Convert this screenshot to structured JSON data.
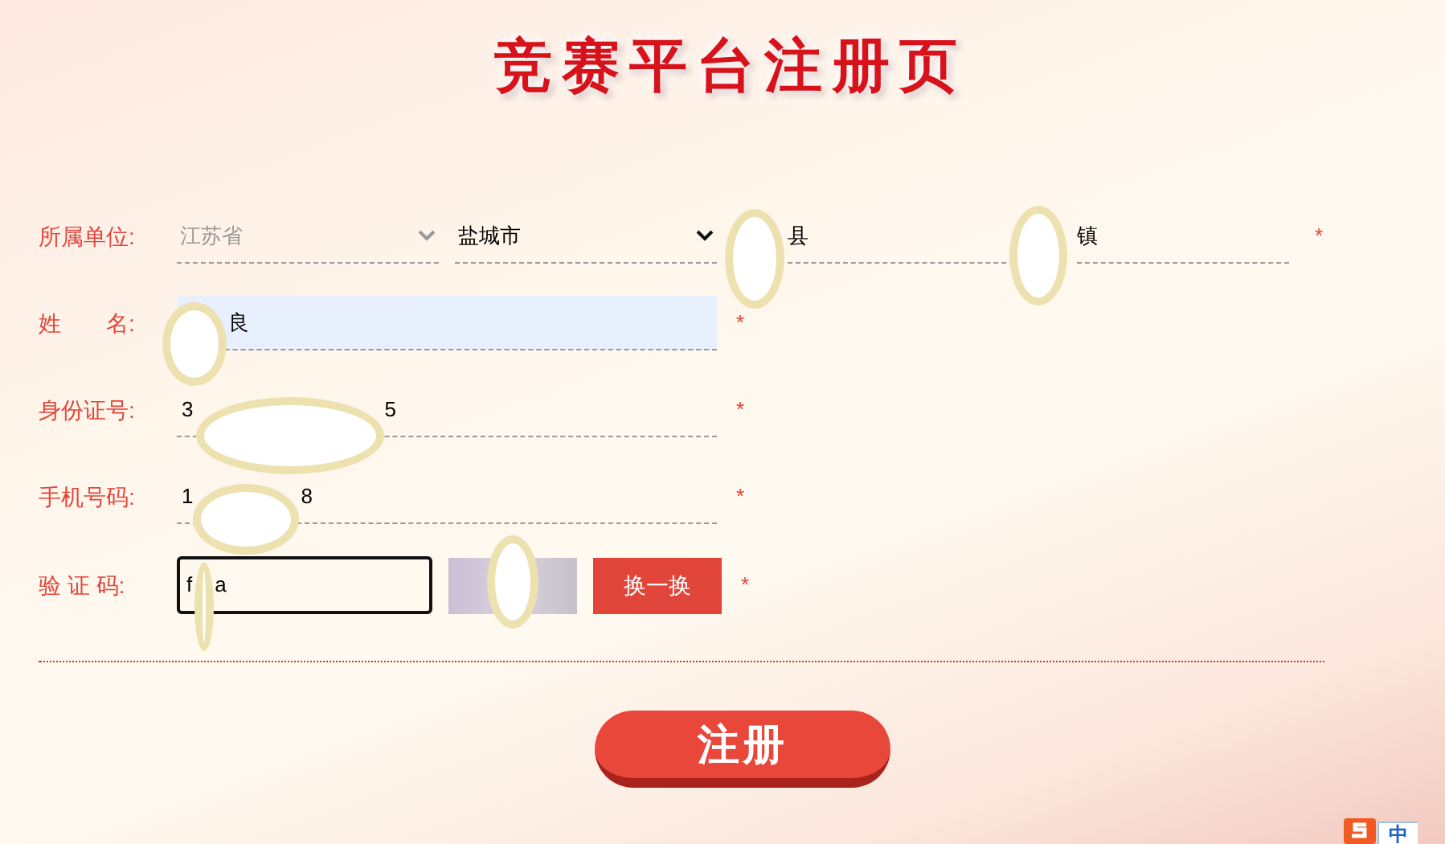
{
  "title": "竞赛平台注册页",
  "rows": [
    {
      "kind": "unit",
      "label": "所属单位:",
      "selects": [
        {
          "value": "江苏省",
          "disabled": true
        },
        {
          "value": "盐城市",
          "disabled": false
        }
      ],
      "inputs": [
        {
          "after": "县",
          "redacted": true
        },
        {
          "after": "镇",
          "redacted": true
        }
      ],
      "required": "*"
    },
    {
      "kind": "text",
      "label": "姓　　名:",
      "after": "良",
      "redacted": true,
      "autofilled": true,
      "required": "*"
    },
    {
      "kind": "text",
      "label": "身份证号:",
      "before": "3",
      "after": "5",
      "redacted": true,
      "autofilled": false,
      "required": "*"
    },
    {
      "kind": "text",
      "label": "手机号码:",
      "before": "1",
      "after": "8",
      "redacted": true,
      "autofilled": false,
      "required": "*"
    },
    {
      "kind": "captcha",
      "label": "验 证 码:",
      "before": "f",
      "after": "a",
      "redacted": true,
      "focused": true,
      "image_redacted": true,
      "refresh": "换一换",
      "required": "*"
    }
  ],
  "submit": "注册",
  "ime": {
    "mode": "中"
  }
}
